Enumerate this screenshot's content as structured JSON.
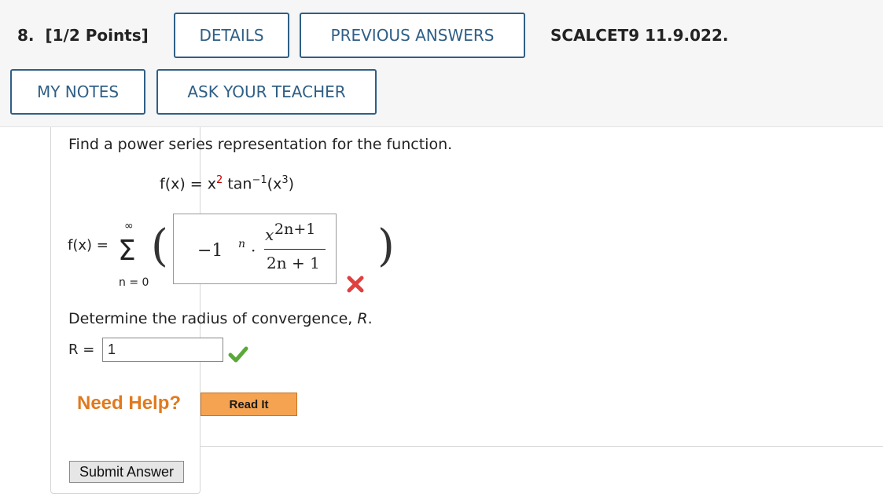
{
  "header": {
    "question_number": "8.",
    "points": "[1/2 Points]",
    "details_label": "DETAILS",
    "previous_answers_label": "PREVIOUS ANSWERS",
    "reference": "SCALCET9 11.9.022.",
    "my_notes_label": "MY NOTES",
    "ask_teacher_label": "ASK YOUR TEACHER"
  },
  "question": {
    "prompt": "Find a power series representation for the function.",
    "function_lhs": "f(x) = x",
    "function_exp1": "2",
    "function_mid": " tan",
    "function_exp2": "−1",
    "function_arg": "(x",
    "function_exp3": "3",
    "function_close": ")",
    "series_lhs": "f(x) =",
    "sum_upper": "∞",
    "sum_symbol": "Σ",
    "sum_lower": "n = 0",
    "answer": {
      "base": "−1",
      "exponent": "n",
      "dot": "·",
      "numerator_base": "x",
      "numerator_exp": "2n+1",
      "denominator": "2n + 1",
      "status": "incorrect"
    },
    "radius_prompt_text": "Determine the radius of convergence, ",
    "radius_prompt_var": "R",
    "radius_prompt_end": ".",
    "radius_label": "R =",
    "radius_value": "1",
    "radius_status": "correct"
  },
  "help": {
    "need_help_label": "Need Help?",
    "read_it_label": "Read It"
  },
  "submit_label": "Submit Answer",
  "colors": {
    "button_border": "#2f5f86",
    "incorrect": "#e0403f",
    "correct": "#5aa83a",
    "help": "#e07a1e",
    "read_it_bg": "#f5a350"
  }
}
